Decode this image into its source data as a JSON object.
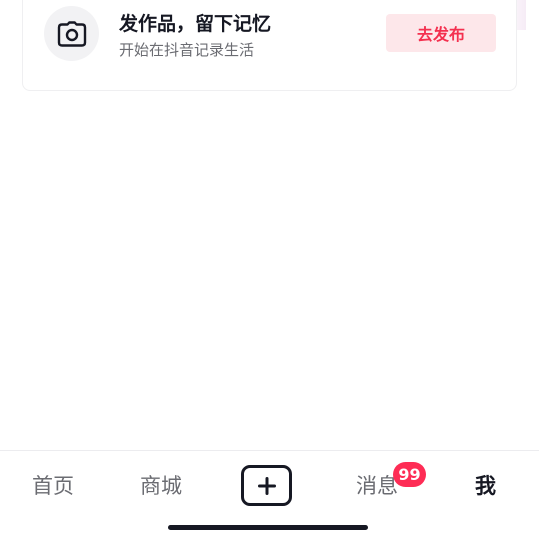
{
  "post_card": {
    "title": "发作品，留下记忆",
    "subtitle": "开始在抖音记录生活",
    "publish_label": "去发布",
    "icon": "camera-icon"
  },
  "tabbar": {
    "home_label": "首页",
    "mall_label": "商城",
    "create_icon": "plus-icon",
    "messages_label": "消息",
    "messages_badge": "99",
    "me_label": "我",
    "active_tab": "我"
  },
  "colors": {
    "accent": "#fe2c55",
    "publish_text": "#f4304f",
    "publish_bg": "#fde7ea",
    "text_primary": "#161823",
    "text_secondary": "#6b6c72"
  }
}
